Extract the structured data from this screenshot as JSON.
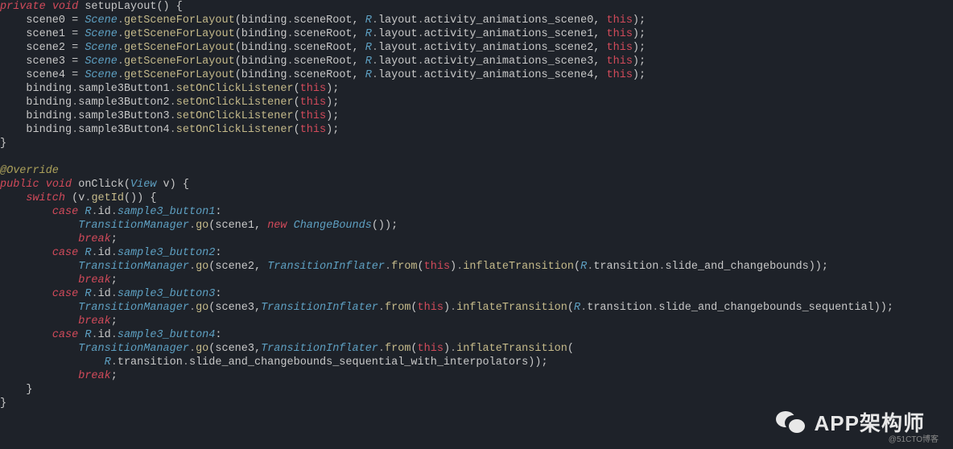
{
  "code": {
    "l1a": "private",
    "l1b": "void",
    "l1c": " setupLayout() {",
    "scenes": [
      {
        "var": "scene0",
        "res": "activity_animations_scene0"
      },
      {
        "var": "scene1",
        "res": "activity_animations_scene1"
      },
      {
        "var": "scene2",
        "res": "activity_animations_scene2"
      },
      {
        "var": "scene3",
        "res": "activity_animations_scene3"
      },
      {
        "var": "scene4",
        "res": "activity_animations_scene4"
      }
    ],
    "scene_class": "Scene",
    "scene_method": "getSceneForLayout",
    "scene_arg1": "binding",
    "scene_arg1b": "sceneRoot",
    "scene_R": "R",
    "scene_layout": "layout",
    "scene_this": "this",
    "bindings": [
      "sample3Button1",
      "sample3Button2",
      "sample3Button3",
      "sample3Button4"
    ],
    "binding_pre": "binding",
    "binding_method": "setOnClickListener",
    "binding_arg": "this",
    "overrideAnnot": "@Override",
    "l_pub": "public",
    "l_void": "void",
    "l_onClick": " onClick(",
    "l_view": "View",
    "l_v": " v) {",
    "switch_kw": "switch",
    "switch_expr": " (v",
    "switch_getid": "getId",
    "switch_tail": "()) {",
    "cases": [
      {
        "id": "sample3_button1",
        "call_pre": "TransitionManager",
        "go": "go",
        "arg": "(scene1, ",
        "new": "new ",
        "cb": "ChangeBounds",
        "tail": "());"
      },
      {
        "id": "sample3_button2",
        "call_pre": "TransitionManager",
        "go": "go",
        "arg": "(scene2, ",
        "inf": "TransitionInflater",
        "from": "from",
        "this": "this",
        "inflT": "inflateTransition",
        "R": "R",
        "trans": "transition",
        "res": "slide_and_changebounds",
        "tail": "));"
      },
      {
        "id": "sample3_button3",
        "call_pre": "TransitionManager",
        "go": "go",
        "arg": "(scene3,",
        "inf": "TransitionInflater",
        "from": "from",
        "this": "this",
        "inflT": "inflateTransition",
        "R": "R",
        "trans": "transition",
        "res": "slide_and_changebounds_sequential",
        "tail": "));"
      },
      {
        "id": "sample3_button4",
        "call_pre": "TransitionManager",
        "go": "go",
        "arg": "(scene3,",
        "inf": "TransitionInflater",
        "from": "from",
        "this": "this",
        "inflT": "inflateTransition",
        "tail": "(",
        "line2R": "R",
        "line2trans": "transition",
        "line2res": "slide_and_changebounds_sequential_with_interpolators",
        "line2tail": "));"
      }
    ],
    "case_kw": "case",
    "R": "R",
    "id": "id",
    "break": "break",
    "close1": "}",
    "close2": "}"
  },
  "watermark": {
    "main": "APP架构师",
    "sub": "@51CTO博客"
  }
}
